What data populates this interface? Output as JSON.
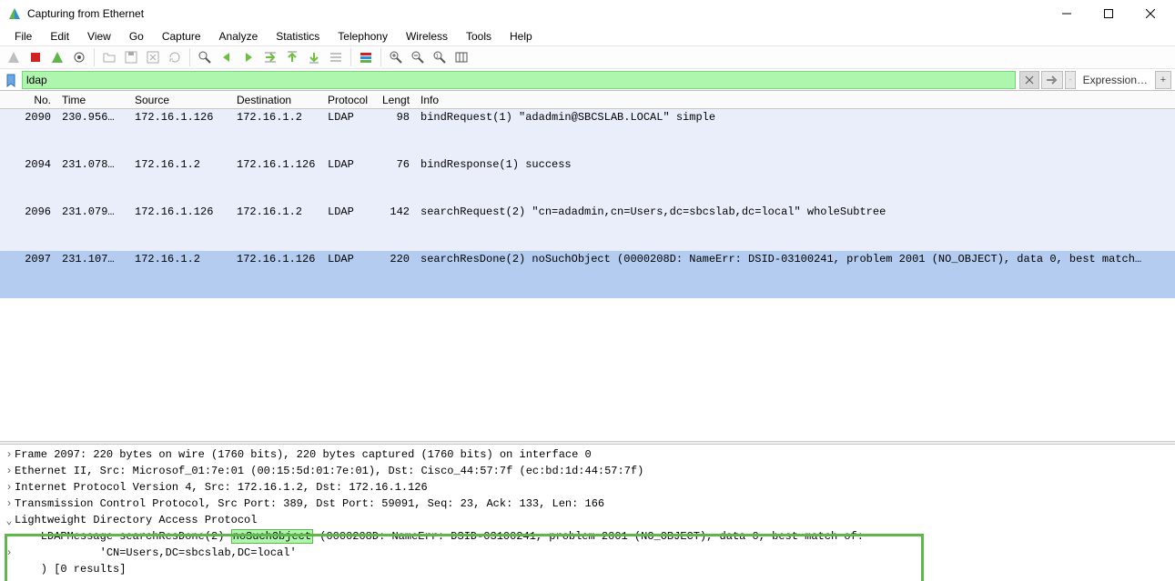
{
  "window": {
    "title": "Capturing from Ethernet"
  },
  "menus": [
    "File",
    "Edit",
    "View",
    "Go",
    "Capture",
    "Analyze",
    "Statistics",
    "Telephony",
    "Wireless",
    "Tools",
    "Help"
  ],
  "filter": {
    "value": "ldap",
    "expression_label": "Expression…"
  },
  "columns": {
    "no": "No.",
    "time": "Time",
    "source": "Source",
    "destination": "Destination",
    "protocol": "Protocol",
    "length": "Lengt",
    "info": "Info"
  },
  "packets": [
    {
      "no": "2090",
      "time": "230.956…",
      "src": "172.16.1.126",
      "dst": "172.16.1.2",
      "prot": "LDAP",
      "len": "98",
      "info": "bindRequest(1) \"adadmin@SBCSLAB.LOCAL\" simple",
      "sel": false
    },
    {
      "no": "2094",
      "time": "231.078…",
      "src": "172.16.1.2",
      "dst": "172.16.1.126",
      "prot": "LDAP",
      "len": "76",
      "info": "bindResponse(1) success",
      "sel": false
    },
    {
      "no": "2096",
      "time": "231.079…",
      "src": "172.16.1.126",
      "dst": "172.16.1.2",
      "prot": "LDAP",
      "len": "142",
      "info": "searchRequest(2) \"cn=adadmin,cn=Users,dc=sbcslab,dc=local\" wholeSubtree",
      "sel": false
    },
    {
      "no": "2097",
      "time": "231.107…",
      "src": "172.16.1.2",
      "dst": "172.16.1.126",
      "prot": "LDAP",
      "len": "220",
      "info": "searchResDone(2) noSuchObject (0000208D: NameErr: DSID-03100241, problem 2001 (NO_OBJECT), data 0, best match…",
      "sel": true
    }
  ],
  "details": {
    "lines": [
      "Frame 2097: 220 bytes on wire (1760 bits), 220 bytes captured (1760 bits) on interface 0",
      "Ethernet II, Src: Microsof_01:7e:01 (00:15:5d:01:7e:01), Dst: Cisco_44:57:7f (ec:bd:1d:44:57:7f)",
      "Internet Protocol Version 4, Src: 172.16.1.2, Dst: 172.16.1.126",
      "Transmission Control Protocol, Src Port: 389, Dst Port: 59091, Seq: 23, Ack: 133, Len: 166",
      "Lightweight Directory Access Protocol"
    ],
    "ldap_msg_pre": "    LDAPMessage searchResDone(2) ",
    "ldap_msg_hl": "noSuchObject",
    "ldap_msg_post": " (0000208D: NameErr: DSID-03100241, problem 2001 (NO_OBJECT), data 0, best match of:",
    "ldap_dn": "             'CN=Users,DC=sbcslab,DC=local'",
    "ldap_end": "    ) [0 results]"
  }
}
